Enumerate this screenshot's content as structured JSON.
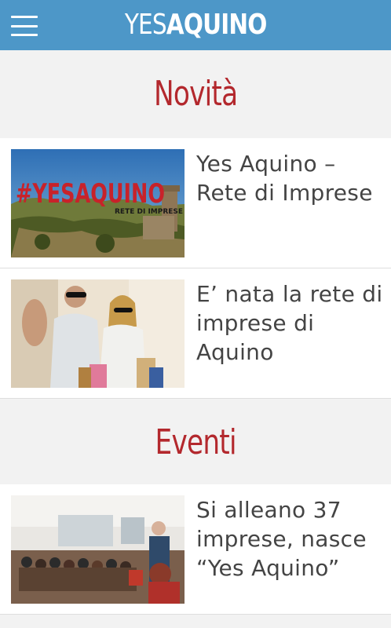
{
  "header": {
    "logo_part1": "YES",
    "logo_part2": "AQUINO",
    "colors": {
      "bar": "#4d97c8",
      "accent": "#b3282d"
    }
  },
  "sections": [
    {
      "title": "Novità",
      "articles": [
        {
          "title": "Yes Aquino – Rete di Imprese",
          "image_text": "#YESAQUINO",
          "image_subtext": "RETE DI IMPRESE"
        },
        {
          "title": "E’ nata la rete di imprese di Aquino"
        }
      ]
    },
    {
      "title": "Eventi",
      "articles": [
        {
          "title": "Si alleano 37 imprese, nasce “Yes Aquino”"
        }
      ]
    }
  ]
}
